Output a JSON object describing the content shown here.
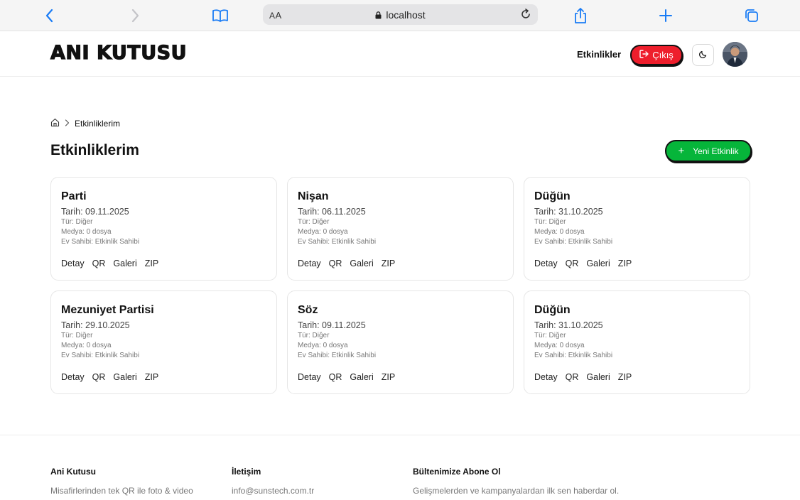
{
  "browser": {
    "aa_small": "A",
    "aa_big": "A",
    "url": "localhost"
  },
  "header": {
    "logo": "ANI KUTUSU",
    "nav_events": "Etkinlikler",
    "logout_label": "Çıkış"
  },
  "breadcrumb": {
    "current": "Etkinliklerim"
  },
  "page": {
    "title": "Etkinliklerim",
    "new_event_label": "Yeni Etkinlik"
  },
  "cards": [
    {
      "title": "Parti",
      "date": "Tarih: 09.11.2025",
      "type": "Tür: Diğer",
      "media": "Medya: 0 dosya",
      "host": "Ev Sahibi: Etkinlik Sahibi"
    },
    {
      "title": "Nişan",
      "date": "Tarih: 06.11.2025",
      "type": "Tür: Diğer",
      "media": "Medya: 0 dosya",
      "host": "Ev Sahibi: Etkinlik Sahibi"
    },
    {
      "title": "Düğün",
      "date": "Tarih: 31.10.2025",
      "type": "Tür: Diğer",
      "media": "Medya: 0 dosya",
      "host": "Ev Sahibi: Etkinlik Sahibi"
    },
    {
      "title": "Mezuniyet Partisi",
      "date": "Tarih: 29.10.2025",
      "type": "Tür: Diğer",
      "media": "Medya: 0 dosya",
      "host": "Ev Sahibi: Etkinlik Sahibi"
    },
    {
      "title": "Söz",
      "date": "Tarih: 09.11.2025",
      "type": "Tür: Diğer",
      "media": "Medya: 0 dosya",
      "host": "Ev Sahibi: Etkinlik Sahibi"
    },
    {
      "title": "Düğün",
      "date": "Tarih: 31.10.2025",
      "type": "Tür: Diğer",
      "media": "Medya: 0 dosya",
      "host": "Ev Sahibi: Etkinlik Sahibi"
    }
  ],
  "card_actions": {
    "detail": "Detay",
    "qr": "QR",
    "gallery": "Galeri",
    "zip": "ZIP"
  },
  "footer": {
    "about_title": "Ani Kutusu",
    "about_text": "Misafirlerinden tek QR ile foto & video",
    "contact_title": "İletişim",
    "contact_email": "info@sunstech.com.tr",
    "newsletter_title": "Bültenimize Abone Ol",
    "newsletter_text": "Gelişmelerden ve kampanyalardan ilk sen haberdar ol."
  },
  "colors": {
    "accent_red": "#ee1e2c",
    "accent_green": "#06b53a",
    "safari_blue": "#1a7cf5"
  },
  "icons": [
    "back-icon",
    "forward-icon",
    "bookmarks-icon",
    "lock-icon",
    "reload-icon",
    "share-icon",
    "new-tab-icon",
    "tabs-icon",
    "logout-icon",
    "moon-icon",
    "home-icon",
    "chevron-right-icon",
    "plus-icon"
  ]
}
